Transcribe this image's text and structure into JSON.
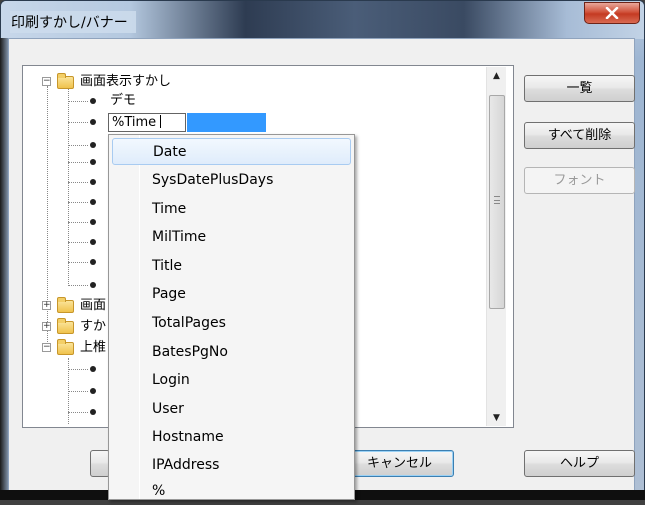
{
  "window": {
    "title": "印刷すかし/バナー"
  },
  "tree": {
    "root": {
      "label": "画面表示すかし",
      "expander": "⊟"
    },
    "first_child": {
      "label": "デモ"
    },
    "editing_value": "%Time",
    "collapsed_1": {
      "label": "画面",
      "expander": "⊞"
    },
    "collapsed_2": {
      "label": "すか",
      "expander": "⊞"
    },
    "expanded_3": {
      "label": "上椎",
      "expander": "⊟"
    }
  },
  "autocomplete": {
    "items": [
      "Date",
      "SysDatePlusDays",
      "Time",
      "MilTime",
      "Title",
      "Page",
      "TotalPages",
      "BatesPgNo",
      "Login",
      "User",
      "Hostname",
      "IPAddress",
      "%"
    ],
    "highlighted_index": 0
  },
  "buttons": {
    "list": "一覧",
    "delete_all": "すべて削除",
    "font": "フォント",
    "cancel": "キャンセル",
    "help": "ヘルプ"
  },
  "colors": {
    "selection": "#3399ff",
    "close_button": "#c43a22"
  }
}
